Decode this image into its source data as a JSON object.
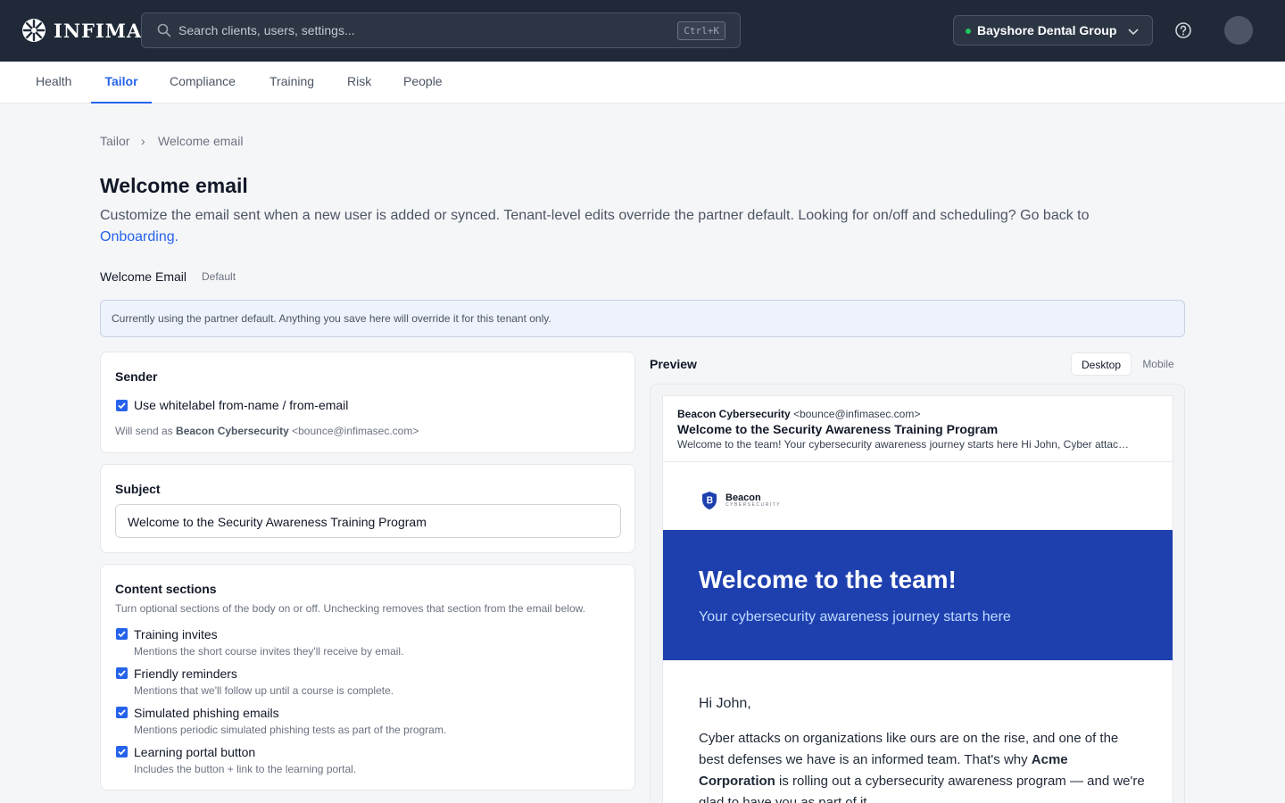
{
  "app": {
    "brand": "INFIMA"
  },
  "search": {
    "placeholder": "Search clients, users, settings...",
    "shortcut": "Ctrl+K"
  },
  "tenant": {
    "name": "Bayshore Dental Group",
    "status_color": "#22c55e"
  },
  "tabs": [
    {
      "label": "Health",
      "active": false
    },
    {
      "label": "Tailor",
      "active": true
    },
    {
      "label": "Compliance",
      "active": false
    },
    {
      "label": "Training",
      "active": false
    },
    {
      "label": "Risk",
      "active": false
    },
    {
      "label": "People",
      "active": false
    }
  ],
  "breadcrumb": {
    "parent": "Tailor",
    "separator": "›",
    "current": "Welcome email"
  },
  "page": {
    "title": "Welcome email",
    "description": "Customize the email sent when a new user is added or synced. Tenant-level edits override the partner default. Looking for on/off and scheduling? Go back to",
    "description_link": "Onboarding."
  },
  "template": {
    "label": "Welcome Email",
    "badge": "Default"
  },
  "notice": "Currently using the partner default. Anything you save here will override it for this tenant only.",
  "sender": {
    "title": "Sender",
    "checkbox_label": "Use whitelabel from-name / from-email",
    "checked": true,
    "hint_prefix": "Will send as",
    "hint_name": "Beacon Cybersecurity",
    "hint_email": "<bounce@infimasec.com>"
  },
  "subject": {
    "title": "Subject",
    "value": "Welcome to the Security Awareness Training Program"
  },
  "content": {
    "title": "Content sections",
    "hint": "Turn optional sections of the body on or off. Unchecking removes that section from the email below.",
    "items": [
      {
        "label": "Training invites",
        "desc": "Mentions the short course invites they'll receive by email.",
        "checked": true
      },
      {
        "label": "Friendly reminders",
        "desc": "Mentions that we'll follow up until a course is complete.",
        "checked": true
      },
      {
        "label": "Simulated phishing emails",
        "desc": "Mentions periodic simulated phishing tests as part of the program.",
        "checked": true
      },
      {
        "label": "Learning portal button",
        "desc": "Includes the button + link to the learning portal.",
        "checked": true
      }
    ]
  },
  "preview": {
    "title": "Preview",
    "modes": [
      "Desktop",
      "Mobile"
    ],
    "active_mode": "Desktop",
    "email": {
      "from_name": "Beacon Cybersecurity",
      "from_email": "<bounce@infimasec.com>",
      "subject": "Welcome to the Security Awareness Training Program",
      "preheader": "Welcome to the team! Your cybersecurity awareness journey starts here Hi John, Cyber attac…",
      "brand_name": "Beacon",
      "brand_tagline": "CYBERSECURITY",
      "hero_title": "Welcome to the team!",
      "hero_subtitle": "Your cybersecurity awareness journey starts here",
      "greeting": "Hi John,",
      "body_1": "Cyber attacks on organizations like ours are on the rise, and one of the best defenses we have is an informed team. That's why",
      "company": "Acme Corporation",
      "body_2": "is rolling out a cybersecurity awareness program — and we're glad to have you as part of it.",
      "hero_color": "#1e40af"
    }
  }
}
